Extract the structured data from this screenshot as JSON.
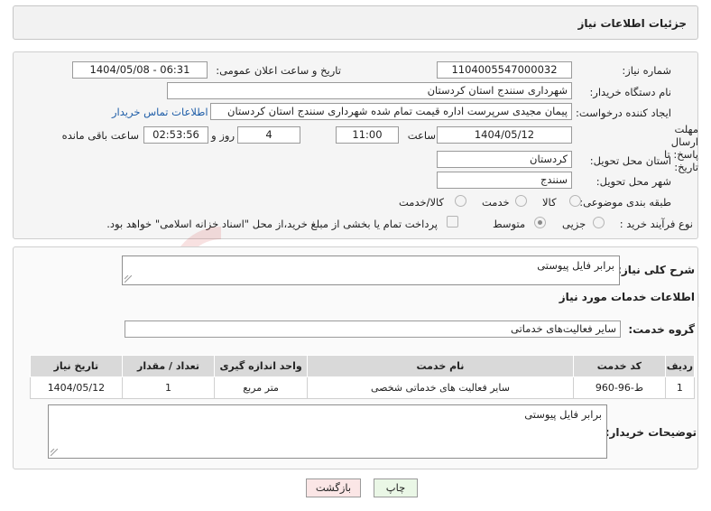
{
  "header": {
    "title": "جزئیات اطلاعات نیاز"
  },
  "form": {
    "need_number_label": "شماره نیاز:",
    "need_number": "1104005547000032",
    "announce_label": "تاریخ و ساعت اعلان عمومی:",
    "announce_value": "1404/05/08 - 06:31",
    "buyer_org_label": "نام دستگاه خریدار:",
    "buyer_org": "شهرداری سنندج استان کردستان",
    "requester_label": "ایجاد کننده درخواست:",
    "requester": "پیمان مجیدی سرپرست اداره قیمت تمام شده شهرداری سنندج استان کردستان",
    "buyer_contact_link": "اطلاعات تماس خریدار",
    "deadline_label": "مهلت ارسال پاسخ: تا تاریخ:",
    "deadline_date": "1404/05/12",
    "time_label": "ساعت",
    "deadline_time": "11:00",
    "days_value": "4",
    "days_label": "روز و",
    "remaining_time": "02:53:56",
    "remaining_label": "ساعت باقی مانده",
    "province_label": "استان محل تحویل:",
    "province": "کردستان",
    "city_label": "شهر محل تحویل:",
    "city": "سنندج",
    "category_label": "طبقه بندی موضوعی:",
    "category_options": [
      "کالا",
      "خدمت",
      "کالا/خدمت"
    ],
    "purchase_type_label": "نوع فرآیند خرید :",
    "purchase_type_options": [
      "جزیی",
      "متوسط"
    ],
    "payment_note": "پرداخت تمام یا بخشی از مبلغ خرید،از محل \"اسناد خزانه اسلامی\" خواهد بود."
  },
  "summary": {
    "general_desc_label": "شرح کلی نیاز:",
    "general_desc": "برابر فایل پیوستی",
    "services_title": "اطلاعات خدمات مورد نیاز",
    "service_group_label": "گروه خدمت:",
    "service_group": "سایر فعالیت‌های خدماتی"
  },
  "table": {
    "headers": [
      "ردیف",
      "کد خدمت",
      "نام خدمت",
      "واحد اندازه گیری",
      "تعداد / مقدار",
      "تاریخ نیاز"
    ],
    "rows": [
      [
        "1",
        "ط-96-960",
        "سایر فعالیت های خدماتی شخصی",
        "متر مربع",
        "1",
        "1404/05/12"
      ]
    ]
  },
  "buyer_notes": {
    "label": "توضیحات خریدار:",
    "text": "برابر فایل پیوستی"
  },
  "buttons": {
    "print": "چاپ",
    "back": "بازگشت"
  },
  "watermark": {
    "text": "AriaTender.neT"
  },
  "colors": {
    "link": "#1f5ea8",
    "print_button": "#eaf7e6",
    "back_button": "#fbe6e6",
    "table_header": "#d9d9d9"
  }
}
